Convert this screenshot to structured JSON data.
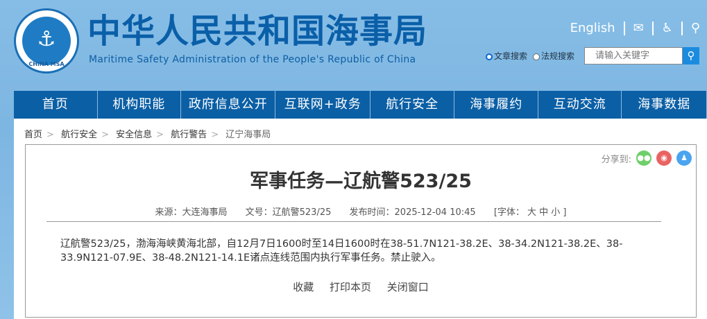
{
  "header": {
    "logo_text": "CHINA MSA",
    "title_cn": "中华人民共和国海事局",
    "title_en": "Maritime Safety Administration of the People's Republic of China",
    "english_link": "English",
    "search_options": [
      "文章搜索",
      "法规搜索"
    ],
    "search_placeholder": "请输入关键字"
  },
  "nav": [
    "首页",
    "机构职能",
    "政府信息公开",
    "互联网+政务",
    "航行安全",
    "海事履约",
    "互动交流",
    "海事数据"
  ],
  "breadcrumb": [
    "首页",
    "航行安全",
    "安全信息",
    "航行警告",
    "辽宁海事局"
  ],
  "article": {
    "share_label": "分享到:",
    "title": "军事任务—辽航警523/25",
    "source": "来源：大连海事局",
    "doc_no": "文号：辽航警523/25",
    "published": "发布时间：2025-12-04 10:45",
    "font_size": "[字体：  大  中  小 ]",
    "body": "辽航警523/25，渤海海峡黄海北部，自12月7日1600时至14日1600时在38-51.7N121-38.2E、38-34.2N121-38.2E、38-33.9N121-07.9E、38-48.2N121-14.1E诸点连线范围内执行军事任务。禁止驶入。",
    "actions": [
      "收藏",
      "打印本页",
      "关闭窗口"
    ]
  }
}
